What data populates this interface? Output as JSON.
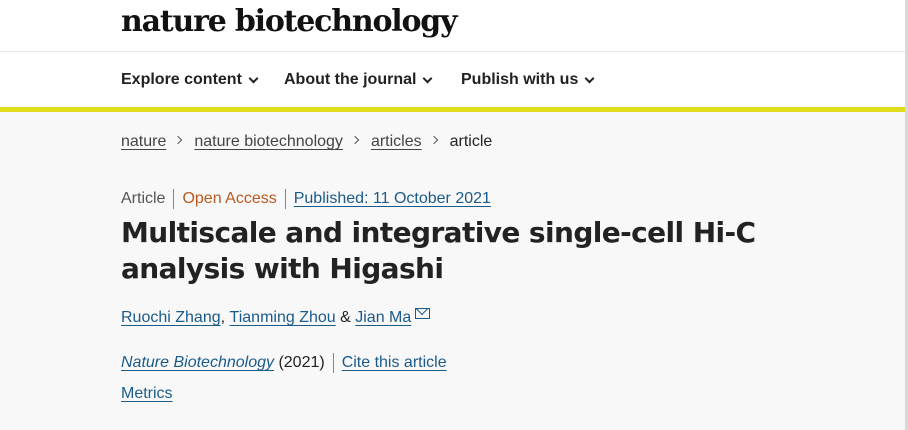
{
  "header": {
    "logo_text": "nature biotechnology"
  },
  "nav": {
    "items": [
      {
        "label": "Explore content"
      },
      {
        "label": "About the journal"
      },
      {
        "label": "Publish with us"
      }
    ]
  },
  "breadcrumb": {
    "items": [
      "nature",
      "nature biotechnology",
      "articles"
    ],
    "current": "article"
  },
  "article": {
    "type": "Article",
    "access": "Open Access",
    "published": "Published: 11 October 2021",
    "title": "Multiscale and integrative single-cell Hi-C analysis with Higashi",
    "authors": [
      "Ruochi Zhang",
      "Tianming Zhou",
      "Jian Ma"
    ],
    "author_sep_comma": ",",
    "author_sep_and": "&",
    "journal": "Nature Biotechnology",
    "year": "(2021)",
    "cite_label": "Cite this article",
    "metrics_label": "Metrics"
  },
  "colors": {
    "accent_yellow": "#e0dc1e",
    "link_blue": "#1b5b8a",
    "open_access_orange": "#b9581f"
  }
}
